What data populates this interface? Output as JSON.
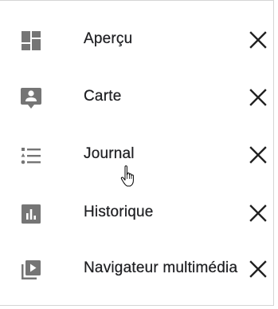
{
  "menu": {
    "items": [
      {
        "label": "Aperçu",
        "icon": "dashboard-icon"
      },
      {
        "label": "Carte",
        "icon": "person-pin-icon"
      },
      {
        "label": "Journal",
        "icon": "list-icon"
      },
      {
        "label": "Historique",
        "icon": "bar-chart-icon"
      },
      {
        "label": "Navigateur multimédia",
        "icon": "video-library-icon"
      }
    ],
    "remove_icon": "close-icon"
  },
  "colors": {
    "icon": "#757575",
    "text": "#202124",
    "close": "#212121",
    "border": "#d5d5d5"
  },
  "cursor": "hand-pointer-icon"
}
